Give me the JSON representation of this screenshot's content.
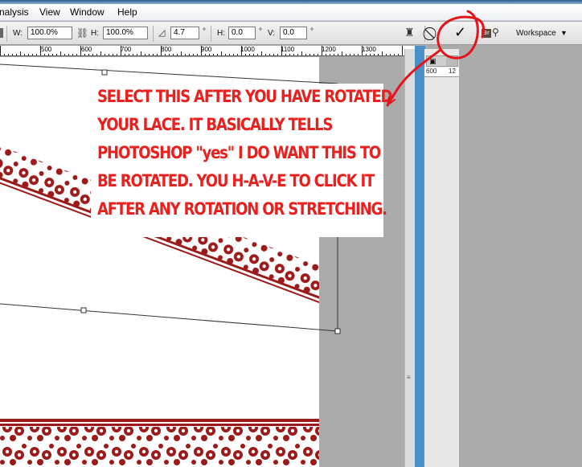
{
  "menu": {
    "items": [
      "nalysis",
      "View",
      "Window",
      "Help"
    ]
  },
  "options": {
    "w_label": "W:",
    "w_value": "100.0%",
    "h_label": "H:",
    "h_value": "100.0%",
    "angle_value": "4.7",
    "degree": "°",
    "skew_h_label": "H:",
    "skew_h_value": "0.0",
    "skew_v_label": "V:",
    "skew_v_value": "0.0",
    "cancel_icon": "cancel-transform-icon",
    "commit_icon": "commit-transform-icon",
    "commit_glyph": "✓",
    "workspace_label": "Workspace"
  },
  "ruler": {
    "ticks": [
      "500",
      "600",
      "700",
      "800",
      "900",
      "1000",
      "1100",
      "1200",
      "1300"
    ]
  },
  "panel": {
    "mini_left": "600",
    "mini_right": "12"
  },
  "annotation": {
    "lines": [
      "SELECT THIS AFTER YOU HAVE ROTATED",
      "YOUR LACE.  IT BASICALLY TELLS",
      "PHOTOSHOP \"yes\" I DO WANT THIS TO",
      "BE ROTATED.  YOU H-A-V-E  TO CLICK IT",
      "AFTER ANY ROTATION OR STRETCHING."
    ],
    "color": "#e8201e"
  },
  "lace_color": "#9c1a1a",
  "highlight_color": "#e3141c"
}
